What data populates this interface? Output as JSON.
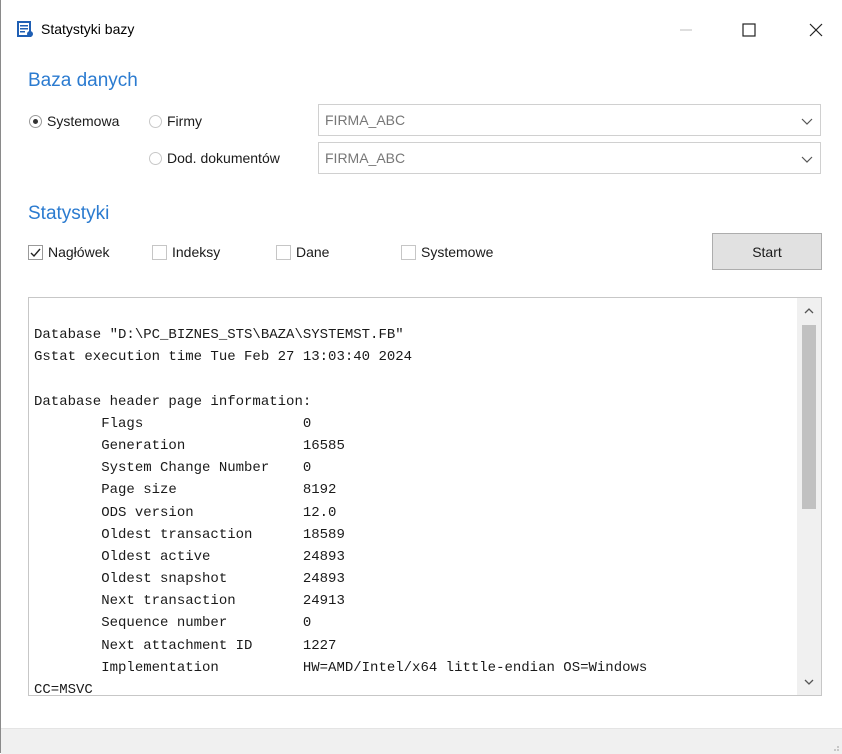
{
  "window": {
    "title": "Statystyki bazy",
    "icon": "database-stats-icon"
  },
  "database_section": {
    "title": "Baza danych",
    "radio_system": "Systemowa",
    "radio_company": "Firmy",
    "radio_documents": "Dod. dokumentów",
    "selected": "Systemowa",
    "company_combo_value": "FIRMA_ABC",
    "documents_combo_value": "FIRMA_ABC"
  },
  "stats_section": {
    "title": "Statystyki",
    "check_header": "Nagłówek",
    "check_indexes": "Indeksy",
    "check_data": "Dane",
    "check_system": "Systemowe",
    "header_checked": true,
    "start_label": "Start"
  },
  "output": {
    "lines": [
      "Database \"D:\\PC_BIZNES_STS\\BAZA\\SYSTEMST.FB\"",
      "Gstat execution time Tue Feb 27 13:03:40 2024",
      "",
      "Database header page information:",
      "        Flags                   0",
      "        Generation              16585",
      "        System Change Number    0",
      "        Page size               8192",
      "        ODS version             12.0",
      "        Oldest transaction      18589",
      "        Oldest active           24893",
      "        Oldest snapshot         24893",
      "        Next transaction        24913",
      "        Sequence number         0",
      "        Next attachment ID      1227",
      "        Implementation          HW=AMD/Intel/x64 little-endian OS=Windows",
      "CC=MSVC"
    ]
  },
  "colors": {
    "accent": "#2b7bd0",
    "button_bg": "#e1e1e1",
    "statusbar_bg": "#f0f0f0"
  }
}
